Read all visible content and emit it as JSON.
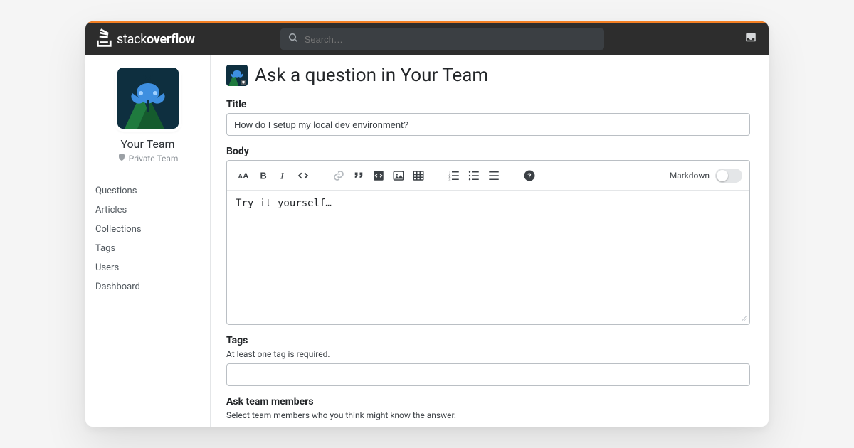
{
  "header": {
    "logo_text_a": "stack",
    "logo_text_b": "overflow",
    "search_placeholder": "Search…"
  },
  "sidebar": {
    "team_name": "Your Team",
    "team_sub": "Private Team",
    "items": [
      {
        "label": "Questions"
      },
      {
        "label": "Articles"
      },
      {
        "label": "Collections"
      },
      {
        "label": "Tags"
      },
      {
        "label": "Users"
      },
      {
        "label": "Dashboard"
      }
    ]
  },
  "main": {
    "heading": "Ask a question in Your Team",
    "title_label": "Title",
    "title_value": "How do I setup my local dev environment?",
    "body_label": "Body",
    "body_value": "Try it yourself…",
    "markdown_label": "Markdown",
    "tags_label": "Tags",
    "tags_sub": "At least one tag is required.",
    "ask_label": "Ask team members",
    "ask_sub": "Select team members who you think might know the answer."
  }
}
